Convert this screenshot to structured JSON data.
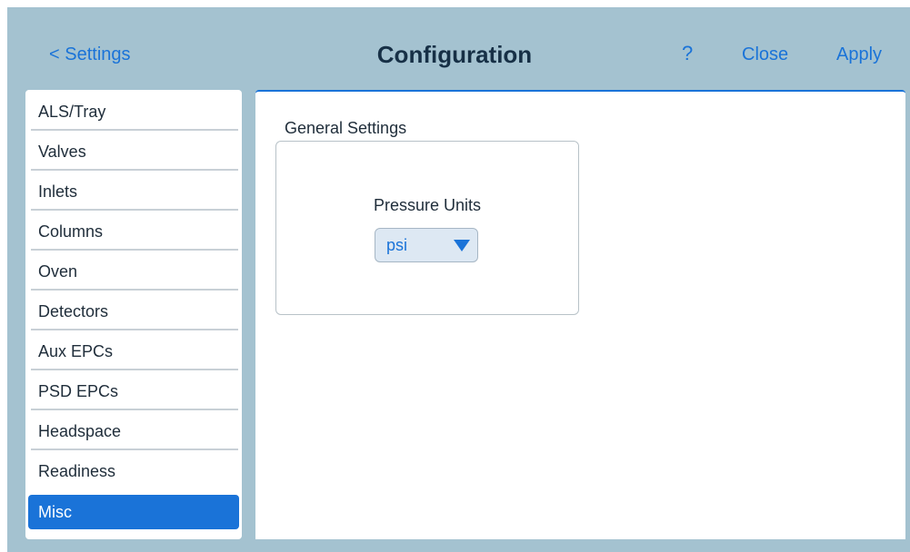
{
  "header": {
    "back_label": "< Settings",
    "title": "Configuration",
    "help_label": "?",
    "close_label": "Close",
    "apply_label": "Apply"
  },
  "sidebar": {
    "items": [
      {
        "label": "ALS/Tray"
      },
      {
        "label": "Valves"
      },
      {
        "label": "Inlets"
      },
      {
        "label": "Columns"
      },
      {
        "label": "Oven"
      },
      {
        "label": "Detectors"
      },
      {
        "label": "Aux EPCs"
      },
      {
        "label": "PSD EPCs"
      },
      {
        "label": "Headspace"
      },
      {
        "label": "Readiness"
      },
      {
        "label": "Misc",
        "selected": true
      }
    ]
  },
  "main": {
    "group_title": "General Settings",
    "pressure_units": {
      "label": "Pressure Units",
      "value": "psi"
    }
  },
  "colors": {
    "accent": "#1a73d8",
    "frame_background": "#a4c2d0",
    "title_text": "#173046"
  }
}
